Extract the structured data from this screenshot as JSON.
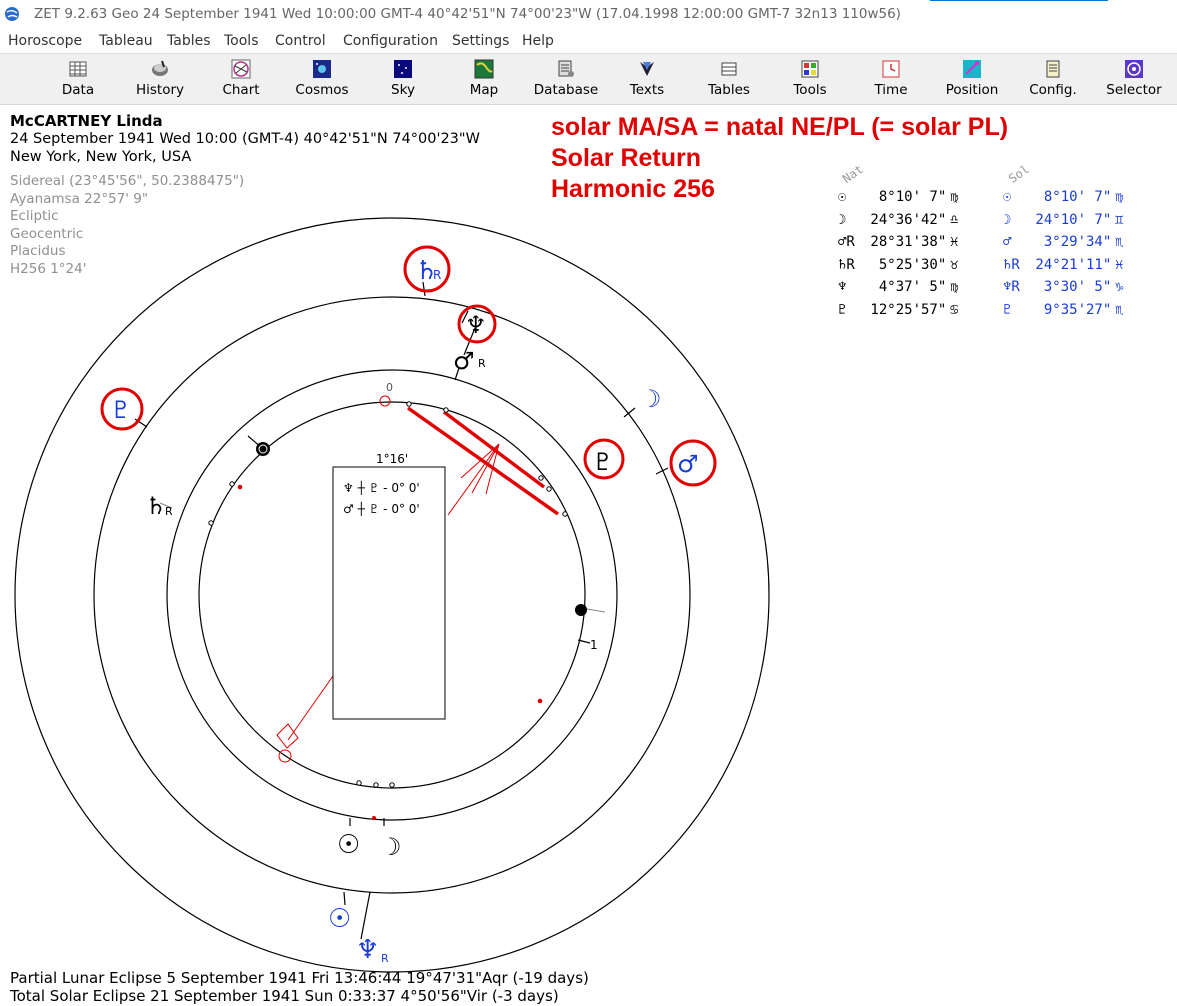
{
  "window": {
    "title": "ZET 9.2.63 Geo   24 September 1941  Wed  10:00:00 GMT-4 40°42'51\"N  74°00'23\"W  (17.04.1998  12:00:00 GMT-7 32n13 110w56)"
  },
  "menu": [
    "Horoscope",
    "Tableau",
    "Tables",
    "Tools",
    "Control",
    "Configuration",
    "Settings",
    "Help"
  ],
  "toolbar": [
    {
      "label": "Data",
      "icon": "data-grid-icon"
    },
    {
      "label": "History",
      "icon": "history-icon"
    },
    {
      "label": "Chart",
      "icon": "chart-wheel-icon"
    },
    {
      "label": "Cosmos",
      "icon": "cosmos-icon"
    },
    {
      "label": "Sky",
      "icon": "sky-icon"
    },
    {
      "label": "Map",
      "icon": "map-icon"
    },
    {
      "label": "Database",
      "icon": "database-icon"
    },
    {
      "label": "Texts",
      "icon": "texts-icon"
    },
    {
      "label": "Tables",
      "icon": "tables-icon"
    },
    {
      "label": "Tools",
      "icon": "tools-icon"
    },
    {
      "label": "Time",
      "icon": "time-icon"
    },
    {
      "label": "Position",
      "icon": "position-icon"
    },
    {
      "label": "Config.",
      "icon": "config-icon"
    },
    {
      "label": "Selector",
      "icon": "selector-icon"
    }
  ],
  "person": {
    "name": "McCARTNEY Linda",
    "datetime": "24 September 1941  Wed  10:00 (GMT-4) 40°42'51\"N  74°00'23\"W",
    "place": "New York, New York, USA"
  },
  "settings": [
    "Sidereal (23°45'56\", 50.2388475\")",
    "Ayanamsa 22°57' 9\"",
    "Ecliptic",
    "Geocentric",
    "Placidus",
    "H256   1°24'"
  ],
  "annotation": [
    "solar MA/SA = natal NE/PL (= solar PL)",
    "Solar Return",
    "Harmonic 256"
  ],
  "table": {
    "nat_header": "Nat",
    "sol_header": "Sol",
    "nat": [
      {
        "glyph": "☉",
        "pos": "  8°10' 7\"",
        "sign": "♍"
      },
      {
        "glyph": "☽",
        "pos": " 24°36'42\"",
        "sign": "♎"
      },
      {
        "glyph": "♂R",
        "pos": " 28°31'38\"",
        "sign": "♓"
      },
      {
        "glyph": "♄R",
        "pos": "  5°25'30\"",
        "sign": "♉"
      },
      {
        "glyph": "♆",
        "pos": "  4°37' 5\"",
        "sign": "♍"
      },
      {
        "glyph": "♇",
        "pos": " 12°25'57\"",
        "sign": "♋"
      }
    ],
    "sol": [
      {
        "glyph": "☉",
        "pos": "  8°10' 7\"",
        "sign": "♍"
      },
      {
        "glyph": "☽",
        "pos": " 24°10' 7\"",
        "sign": "♊"
      },
      {
        "glyph": "♂",
        "pos": "  3°29'34\"",
        "sign": "♏"
      },
      {
        "glyph": "♄R",
        "pos": " 24°21'11\"",
        "sign": "♓"
      },
      {
        "glyph": "♆R",
        "pos": "  3°30' 5\"",
        "sign": "♑"
      },
      {
        "glyph": "♇",
        "pos": "  9°35'27\"",
        "sign": "♏"
      }
    ]
  },
  "chart": {
    "orb_box_title": "1°16'",
    "orb_box_rows": [
      "♆ ┼ ♇ - 0° 0'",
      "♂ ┼ ♇ - 0° 0'"
    ],
    "tick_zero": "0",
    "tick_one": "1",
    "retro_mark": "R"
  },
  "footer": [
    "Partial Lunar Eclipse 5 September 1941 Fri 13:46:44 19°47'31\"Aqr (-19 days)",
    "Total Solar Eclipse 21 September 1941 Sun  0:33:37  4°50'56\"Vir (-3 days)"
  ],
  "colors": {
    "annotation": "#e00000",
    "solar": "#1a3cd6",
    "natal": "#000000",
    "aspect": "#e00000"
  }
}
